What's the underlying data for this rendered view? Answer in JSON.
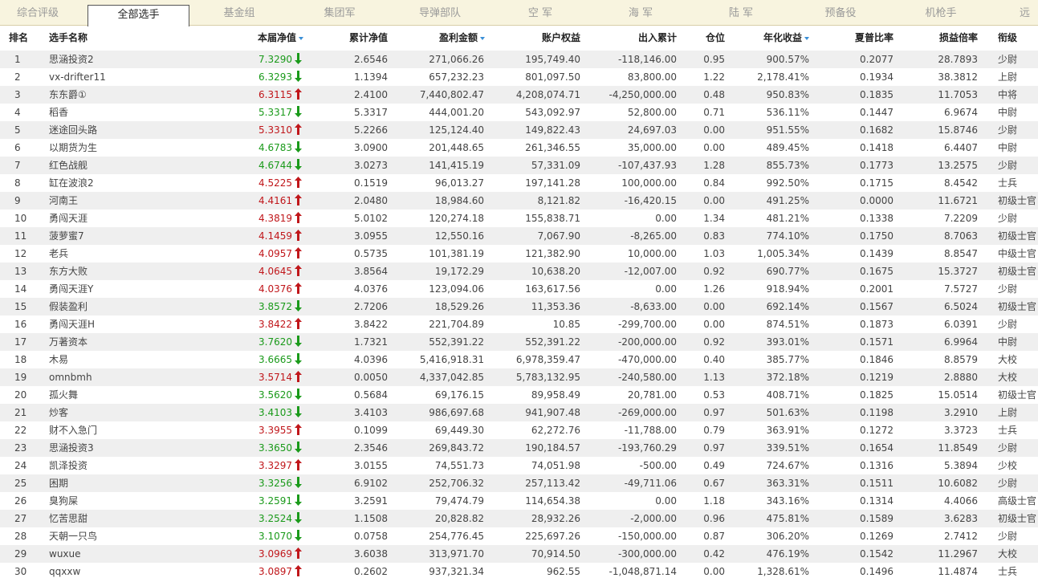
{
  "tabs": [
    {
      "label": "综合评级",
      "active": false
    },
    {
      "label": "全部选手",
      "active": true
    },
    {
      "label": "基金组",
      "active": false
    },
    {
      "label": "集团军",
      "active": false
    },
    {
      "label": "导弹部队",
      "active": false
    },
    {
      "label": "空  军",
      "active": false
    },
    {
      "label": "海  军",
      "active": false
    },
    {
      "label": "陆  军",
      "active": false
    },
    {
      "label": "预备役",
      "active": false
    },
    {
      "label": "机枪手",
      "active": false
    },
    {
      "label": "远",
      "active": false
    }
  ],
  "headers": {
    "rank": "排名",
    "name": "选手名称",
    "nav": "本届净值",
    "cum_nav": "累计净值",
    "profit": "盈利金额",
    "equity": "账户权益",
    "inout": "出入累计",
    "position": "仓位",
    "annual": "年化收益",
    "sharpe": "夏普比率",
    "pl_ratio": "损益倍率",
    "rank_title": "衔级"
  },
  "colors": {
    "up": "#c0161a",
    "down": "#1a9a1a",
    "sort": "#3a8fd6",
    "tabbar": "#f8f4df",
    "row_alt": "#efefef"
  },
  "rows": [
    {
      "rank": "1",
      "name": "思涵投资2",
      "nav": "7.3290",
      "dir": "down",
      "cum_nav": "2.6546",
      "profit": "271,066.26",
      "equity": "195,749.40",
      "inout": "-118,146.00",
      "position": "0.95",
      "annual": "900.57%",
      "sharpe": "0.2077",
      "pl_ratio": "28.7893",
      "title": "少尉"
    },
    {
      "rank": "2",
      "name": "vx-drifter11",
      "nav": "6.3293",
      "dir": "down",
      "cum_nav": "1.1394",
      "profit": "657,232.23",
      "equity": "801,097.50",
      "inout": "83,800.00",
      "position": "1.22",
      "annual": "2,178.41%",
      "sharpe": "0.1934",
      "pl_ratio": "38.3812",
      "title": "上尉"
    },
    {
      "rank": "3",
      "name": "东东爵①",
      "nav": "6.3115",
      "dir": "up",
      "cum_nav": "2.4100",
      "profit": "7,440,802.47",
      "equity": "4,208,074.71",
      "inout": "-4,250,000.00",
      "position": "0.48",
      "annual": "950.83%",
      "sharpe": "0.1835",
      "pl_ratio": "11.7053",
      "title": "中将"
    },
    {
      "rank": "4",
      "name": "稻香",
      "nav": "5.3317",
      "dir": "down",
      "cum_nav": "5.3317",
      "profit": "444,001.20",
      "equity": "543,092.97",
      "inout": "52,800.00",
      "position": "0.71",
      "annual": "536.11%",
      "sharpe": "0.1447",
      "pl_ratio": "6.9674",
      "title": "中尉"
    },
    {
      "rank": "5",
      "name": "迷途回头路",
      "nav": "5.3310",
      "dir": "up",
      "cum_nav": "5.2266",
      "profit": "125,124.40",
      "equity": "149,822.43",
      "inout": "24,697.03",
      "position": "0.00",
      "annual": "951.55%",
      "sharpe": "0.1682",
      "pl_ratio": "15.8746",
      "title": "少尉"
    },
    {
      "rank": "6",
      "name": "以期货为生",
      "nav": "4.6783",
      "dir": "down",
      "cum_nav": "3.0900",
      "profit": "201,448.65",
      "equity": "261,346.55",
      "inout": "35,000.00",
      "position": "0.00",
      "annual": "489.45%",
      "sharpe": "0.1418",
      "pl_ratio": "6.4407",
      "title": "中尉"
    },
    {
      "rank": "7",
      "name": "红色战舰",
      "nav": "4.6744",
      "dir": "down",
      "cum_nav": "3.0273",
      "profit": "141,415.19",
      "equity": "57,331.09",
      "inout": "-107,437.93",
      "position": "1.28",
      "annual": "855.73%",
      "sharpe": "0.1773",
      "pl_ratio": "13.2575",
      "title": "少尉"
    },
    {
      "rank": "8",
      "name": "缸在波浪2",
      "nav": "4.5225",
      "dir": "up",
      "cum_nav": "0.1519",
      "profit": "96,013.27",
      "equity": "197,141.28",
      "inout": "100,000.00",
      "position": "0.84",
      "annual": "992.50%",
      "sharpe": "0.1715",
      "pl_ratio": "8.4542",
      "title": "士兵"
    },
    {
      "rank": "9",
      "name": "河南王",
      "nav": "4.4161",
      "dir": "up",
      "cum_nav": "2.0480",
      "profit": "18,984.60",
      "equity": "8,121.82",
      "inout": "-16,420.15",
      "position": "0.00",
      "annual": "491.25%",
      "sharpe": "0.0000",
      "pl_ratio": "11.6721",
      "title": "初级士官"
    },
    {
      "rank": "10",
      "name": "勇闯天涯",
      "nav": "4.3819",
      "dir": "up",
      "cum_nav": "5.0102",
      "profit": "120,274.18",
      "equity": "155,838.71",
      "inout": "0.00",
      "position": "1.34",
      "annual": "481.21%",
      "sharpe": "0.1338",
      "pl_ratio": "7.2209",
      "title": "少尉"
    },
    {
      "rank": "11",
      "name": "菠萝蜜7",
      "nav": "4.1459",
      "dir": "up",
      "cum_nav": "3.0955",
      "profit": "12,550.16",
      "equity": "7,067.90",
      "inout": "-8,265.00",
      "position": "0.83",
      "annual": "774.10%",
      "sharpe": "0.1750",
      "pl_ratio": "8.7063",
      "title": "初级士官"
    },
    {
      "rank": "12",
      "name": "老兵",
      "nav": "4.0957",
      "dir": "up",
      "cum_nav": "0.5735",
      "profit": "101,381.19",
      "equity": "121,382.90",
      "inout": "10,000.00",
      "position": "1.03",
      "annual": "1,005.34%",
      "sharpe": "0.1439",
      "pl_ratio": "8.8547",
      "title": "中级士官"
    },
    {
      "rank": "13",
      "name": "东方大败",
      "nav": "4.0645",
      "dir": "up",
      "cum_nav": "3.8564",
      "profit": "19,172.29",
      "equity": "10,638.20",
      "inout": "-12,007.00",
      "position": "0.92",
      "annual": "690.77%",
      "sharpe": "0.1675",
      "pl_ratio": "15.3727",
      "title": "初级士官"
    },
    {
      "rank": "14",
      "name": "勇闯天涯Y",
      "nav": "4.0376",
      "dir": "up",
      "cum_nav": "4.0376",
      "profit": "123,094.06",
      "equity": "163,617.56",
      "inout": "0.00",
      "position": "1.26",
      "annual": "918.94%",
      "sharpe": "0.2001",
      "pl_ratio": "7.5727",
      "title": "少尉"
    },
    {
      "rank": "15",
      "name": "假装盈利",
      "nav": "3.8572",
      "dir": "down",
      "cum_nav": "2.7206",
      "profit": "18,529.26",
      "equity": "11,353.36",
      "inout": "-8,633.00",
      "position": "0.00",
      "annual": "692.14%",
      "sharpe": "0.1567",
      "pl_ratio": "6.5024",
      "title": "初级士官"
    },
    {
      "rank": "16",
      "name": "勇闯天涯H",
      "nav": "3.8422",
      "dir": "up",
      "cum_nav": "3.8422",
      "profit": "221,704.89",
      "equity": "10.85",
      "inout": "-299,700.00",
      "position": "0.00",
      "annual": "874.51%",
      "sharpe": "0.1873",
      "pl_ratio": "6.0391",
      "title": "少尉"
    },
    {
      "rank": "17",
      "name": "万著资本",
      "nav": "3.7620",
      "dir": "down",
      "cum_nav": "1.7321",
      "profit": "552,391.22",
      "equity": "552,391.22",
      "inout": "-200,000.00",
      "position": "0.92",
      "annual": "393.01%",
      "sharpe": "0.1571",
      "pl_ratio": "6.9964",
      "title": "中尉"
    },
    {
      "rank": "18",
      "name": "木易",
      "nav": "3.6665",
      "dir": "down",
      "cum_nav": "4.0396",
      "profit": "5,416,918.31",
      "equity": "6,978,359.47",
      "inout": "-470,000.00",
      "position": "0.40",
      "annual": "385.77%",
      "sharpe": "0.1846",
      "pl_ratio": "8.8579",
      "title": "大校"
    },
    {
      "rank": "19",
      "name": "omnbmh",
      "nav": "3.5714",
      "dir": "up",
      "cum_nav": "0.0050",
      "profit": "4,337,042.85",
      "equity": "5,783,132.95",
      "inout": "-240,580.00",
      "position": "1.13",
      "annual": "372.18%",
      "sharpe": "0.1219",
      "pl_ratio": "2.8880",
      "title": "大校"
    },
    {
      "rank": "20",
      "name": "孤火舞",
      "nav": "3.5620",
      "dir": "down",
      "cum_nav": "0.5684",
      "profit": "69,176.15",
      "equity": "89,958.49",
      "inout": "20,781.00",
      "position": "0.53",
      "annual": "408.71%",
      "sharpe": "0.1825",
      "pl_ratio": "15.0514",
      "title": "初级士官"
    },
    {
      "rank": "21",
      "name": "炒客",
      "nav": "3.4103",
      "dir": "down",
      "cum_nav": "3.4103",
      "profit": "986,697.68",
      "equity": "941,907.48",
      "inout": "-269,000.00",
      "position": "0.97",
      "annual": "501.63%",
      "sharpe": "0.1198",
      "pl_ratio": "3.2910",
      "title": "上尉"
    },
    {
      "rank": "22",
      "name": "财不入急门",
      "nav": "3.3955",
      "dir": "up",
      "cum_nav": "0.1099",
      "profit": "69,449.30",
      "equity": "62,272.76",
      "inout": "-11,788.00",
      "position": "0.79",
      "annual": "363.91%",
      "sharpe": "0.1272",
      "pl_ratio": "3.3723",
      "title": "士兵"
    },
    {
      "rank": "23",
      "name": "思涵投资3",
      "nav": "3.3650",
      "dir": "down",
      "cum_nav": "2.3546",
      "profit": "269,843.72",
      "equity": "190,184.57",
      "inout": "-193,760.29",
      "position": "0.97",
      "annual": "339.51%",
      "sharpe": "0.1654",
      "pl_ratio": "11.8549",
      "title": "少尉"
    },
    {
      "rank": "24",
      "name": "凯泽投资",
      "nav": "3.3297",
      "dir": "up",
      "cum_nav": "3.0155",
      "profit": "74,551.73",
      "equity": "74,051.98",
      "inout": "-500.00",
      "position": "0.49",
      "annual": "724.67%",
      "sharpe": "0.1316",
      "pl_ratio": "5.3894",
      "title": "少校"
    },
    {
      "rank": "25",
      "name": "困期",
      "nav": "3.3256",
      "dir": "down",
      "cum_nav": "6.9102",
      "profit": "252,706.32",
      "equity": "257,113.42",
      "inout": "-49,711.06",
      "position": "0.67",
      "annual": "363.31%",
      "sharpe": "0.1511",
      "pl_ratio": "10.6082",
      "title": "少尉"
    },
    {
      "rank": "26",
      "name": "臭狗屎",
      "nav": "3.2591",
      "dir": "down",
      "cum_nav": "3.2591",
      "profit": "79,474.79",
      "equity": "114,654.38",
      "inout": "0.00",
      "position": "1.18",
      "annual": "343.16%",
      "sharpe": "0.1314",
      "pl_ratio": "4.4066",
      "title": "高级士官"
    },
    {
      "rank": "27",
      "name": "忆苦思甜",
      "nav": "3.2524",
      "dir": "down",
      "cum_nav": "1.1508",
      "profit": "20,828.82",
      "equity": "28,932.26",
      "inout": "-2,000.00",
      "position": "0.96",
      "annual": "475.81%",
      "sharpe": "0.1589",
      "pl_ratio": "3.6283",
      "title": "初级士官"
    },
    {
      "rank": "28",
      "name": "天朝一只鸟",
      "nav": "3.1070",
      "dir": "down",
      "cum_nav": "0.0758",
      "profit": "254,776.45",
      "equity": "225,697.26",
      "inout": "-150,000.00",
      "position": "0.87",
      "annual": "306.20%",
      "sharpe": "0.1269",
      "pl_ratio": "2.7412",
      "title": "少尉"
    },
    {
      "rank": "29",
      "name": "wuxue",
      "nav": "3.0969",
      "dir": "up",
      "cum_nav": "3.6038",
      "profit": "313,971.70",
      "equity": "70,914.50",
      "inout": "-300,000.00",
      "position": "0.42",
      "annual": "476.19%",
      "sharpe": "0.1542",
      "pl_ratio": "11.2967",
      "title": "大校"
    },
    {
      "rank": "30",
      "name": "qqxxw",
      "nav": "3.0897",
      "dir": "up",
      "cum_nav": "0.2602",
      "profit": "937,321.34",
      "equity": "962.55",
      "inout": "-1,048,871.14",
      "position": "0.00",
      "annual": "1,328.61%",
      "sharpe": "0.1496",
      "pl_ratio": "11.4874",
      "title": "士兵"
    }
  ]
}
